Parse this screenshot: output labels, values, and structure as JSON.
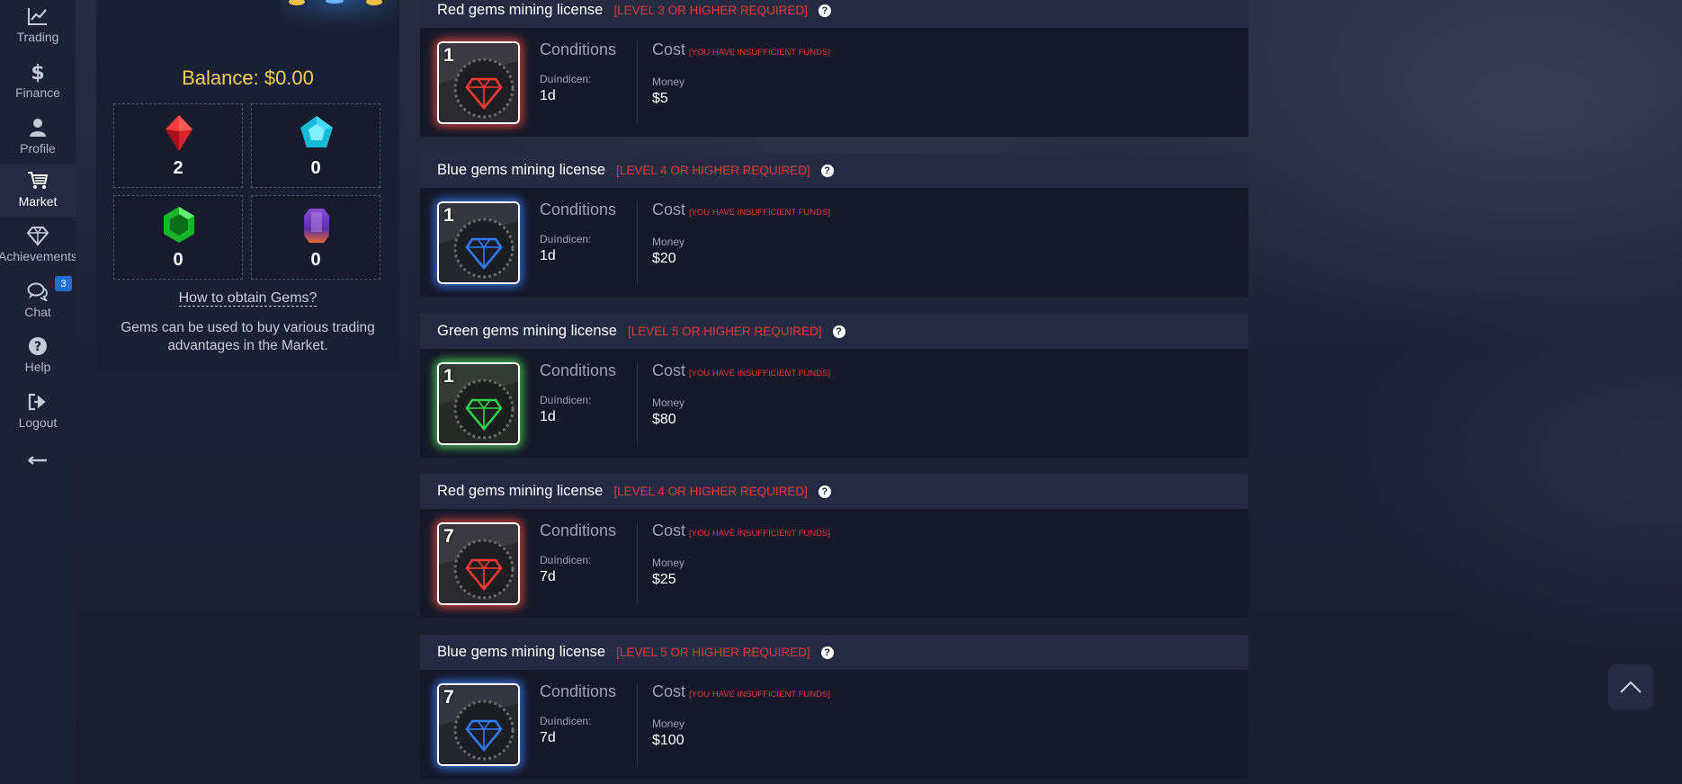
{
  "sidebar": {
    "items": [
      {
        "label": "Trading",
        "icon": "chart-line-icon"
      },
      {
        "label": "Finance",
        "icon": "dollar-icon"
      },
      {
        "label": "Profile",
        "icon": "user-icon"
      },
      {
        "label": "Market",
        "icon": "cart-icon",
        "active": true
      },
      {
        "label": "Achievements",
        "icon": "diamond-icon"
      },
      {
        "label": "Chat",
        "icon": "chat-icon",
        "badge": "3"
      },
      {
        "label": "Help",
        "icon": "help-icon"
      },
      {
        "label": "Logout",
        "icon": "logout-icon"
      }
    ],
    "collapse_icon": "arrow-left-icon"
  },
  "gems_panel": {
    "balance": "Balance: $0.00",
    "gems": [
      {
        "type": "red",
        "count": "2"
      },
      {
        "type": "cyan",
        "count": "0"
      },
      {
        "type": "green",
        "count": "0"
      },
      {
        "type": "purple",
        "count": "0"
      }
    ],
    "obtain_link": "How to obtain Gems?",
    "description": "Gems can be used to buy various trading advantages in the Market."
  },
  "licenses": [
    {
      "title": "Red gems mining license",
      "requirement": "[LEVEL 3 OR HIGHER REQUIRED]",
      "color": "red",
      "days_badge": "1",
      "conditions_label": "Conditions",
      "duration_label": "Duíndicen:",
      "duration": "1d",
      "cost_label": "Cost",
      "cost_warning": "[YOU HAVE INSUFFICIENT FUNDS]",
      "money_label": "Money",
      "money": "$5"
    },
    {
      "title": "Blue gems mining license",
      "requirement": "[LEVEL 4 OR HIGHER REQUIRED]",
      "color": "blue",
      "days_badge": "1",
      "conditions_label": "Conditions",
      "duration_label": "Duíndicen:",
      "duration": "1d",
      "cost_label": "Cost",
      "cost_warning": "[YOU HAVE INSUFFICIENT FUNDS]",
      "money_label": "Money",
      "money": "$20"
    },
    {
      "title": "Green gems mining license",
      "requirement": "[LEVEL 5 OR HIGHER REQUIRED]",
      "color": "green",
      "days_badge": "1",
      "conditions_label": "Conditions",
      "duration_label": "Duíndicen:",
      "duration": "1d",
      "cost_label": "Cost",
      "cost_warning": "[YOU HAVE INSUFFICIENT FUNDS]",
      "money_label": "Money",
      "money": "$80"
    },
    {
      "title": "Red gems mining license",
      "requirement": "[LEVEL 4 OR HIGHER REQUIRED]",
      "color": "red",
      "days_badge": "7",
      "conditions_label": "Conditions",
      "duration_label": "Duíndicen:",
      "duration": "7d",
      "cost_label": "Cost",
      "cost_warning": "[YOU HAVE INSUFFICIENT FUNDS]",
      "money_label": "Money",
      "money": "$25"
    },
    {
      "title": "Blue gems mining license",
      "requirement": "[LEVEL 5 OR HIGHER REQUIRED]",
      "color": "blue",
      "days_badge": "7",
      "conditions_label": "Conditions",
      "duration_label": "Duíndicen:",
      "duration": "7d",
      "cost_label": "Cost",
      "cost_warning": "[YOU HAVE INSUFFICIENT FUNDS]",
      "money_label": "Money",
      "money": "$100"
    }
  ],
  "colors": {
    "balance": "#f4cf5d",
    "warning": "#e03b3b",
    "red_glow": "#e6463c",
    "blue_glow": "#3c78f0",
    "green_glow": "#50d250"
  },
  "scroll_top_icon": "chevron-up-icon"
}
